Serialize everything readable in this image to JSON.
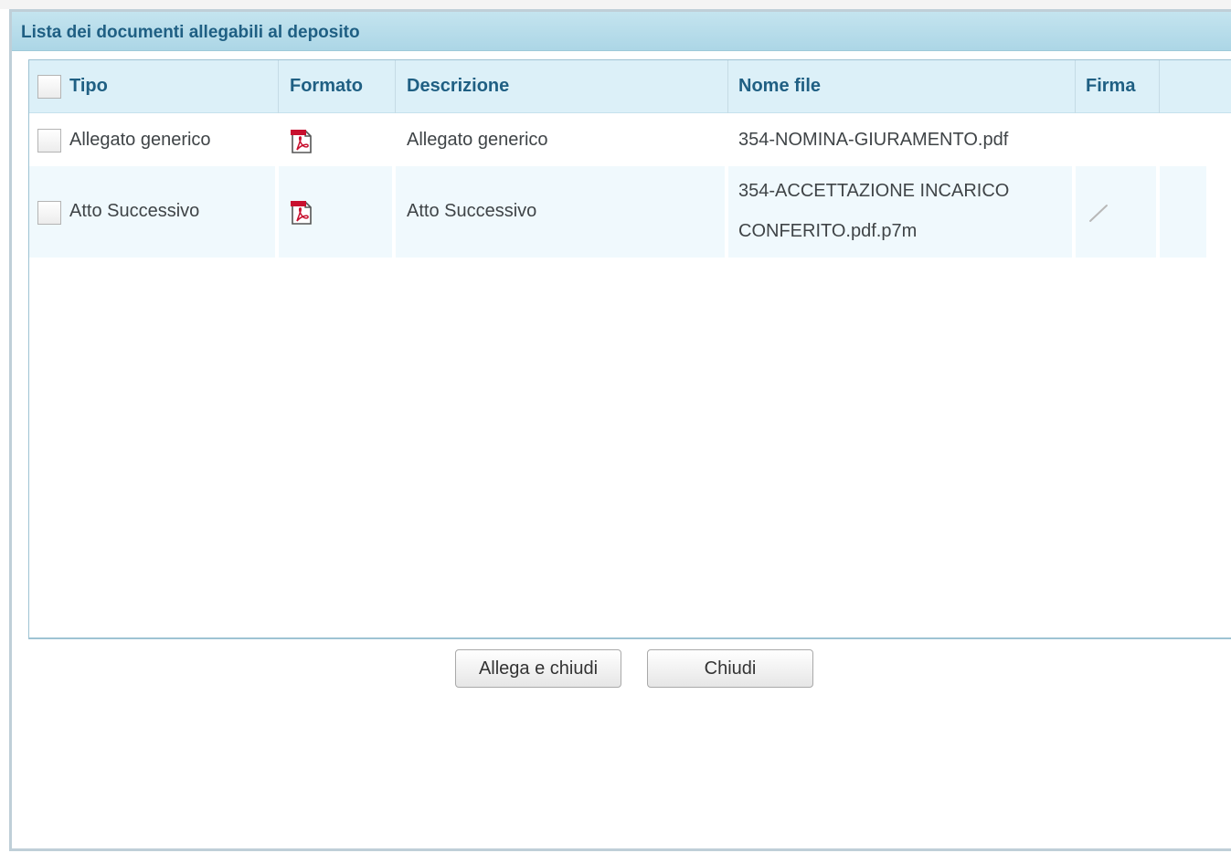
{
  "dialog": {
    "title": "Lista dei documenti allegabili al deposito"
  },
  "table": {
    "columns": [
      {
        "key": "tipo",
        "label": "Tipo"
      },
      {
        "key": "formato",
        "label": "Formato"
      },
      {
        "key": "descrizione",
        "label": "Descrizione"
      },
      {
        "key": "nome_file",
        "label": "Nome file"
      },
      {
        "key": "firma",
        "label": "Firma"
      },
      {
        "key": "extra",
        "label": ""
      }
    ],
    "rows": [
      {
        "tipo": "Allegato generico",
        "formato_icon": "pdf-icon",
        "descrizione": "Allegato generico",
        "nome_file_line1": "354-NOMINA-GIURAMENTO.pdf",
        "nome_file_line2": "",
        "firma_icon": "",
        "checked": false
      },
      {
        "tipo": "Atto Successivo",
        "formato_icon": "pdf-icon",
        "descrizione": "Atto Successivo",
        "nome_file_line1": "354-ACCETTAZIONE INCARICO",
        "nome_file_line2": "CONFERITO.pdf.p7m",
        "firma_icon": "signature-pen-icon",
        "checked": false
      }
    ]
  },
  "buttons": {
    "attach_close": "Allega e chiudi",
    "close": "Chiudi"
  }
}
